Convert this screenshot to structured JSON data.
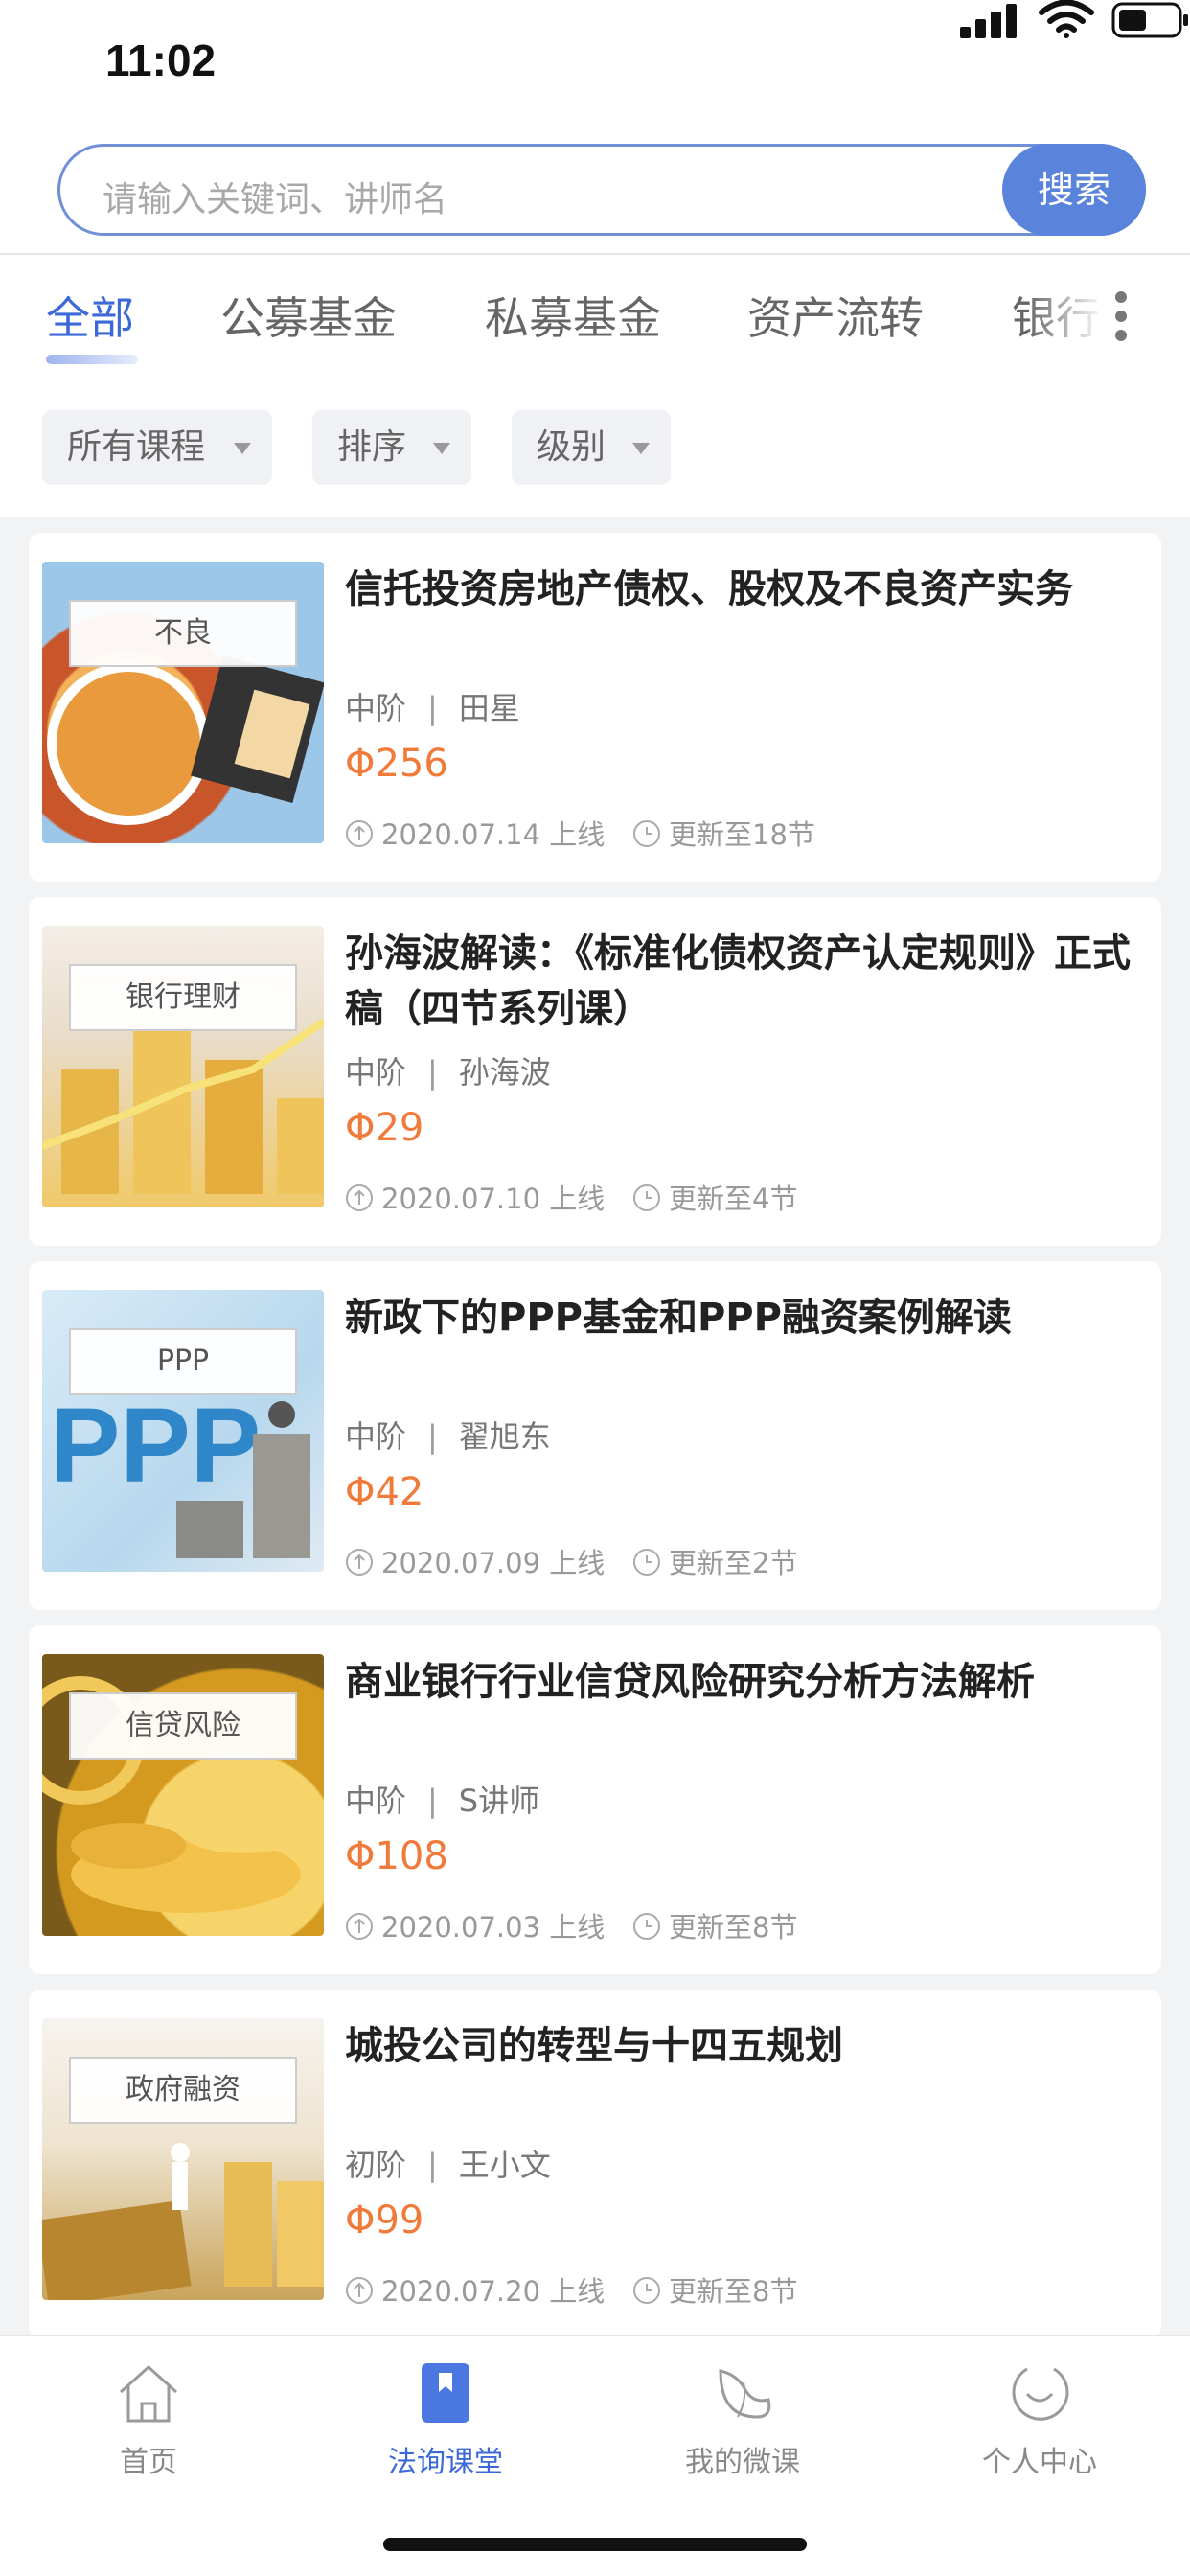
{
  "status_bar": {
    "time": "11:02"
  },
  "search": {
    "placeholder": "请输入关键词、讲师名",
    "button_label": "搜索"
  },
  "tabs": [
    {
      "label": "全部",
      "active": true
    },
    {
      "label": "公募基金",
      "active": false
    },
    {
      "label": "私募基金",
      "active": false
    },
    {
      "label": "资产流转",
      "active": false
    },
    {
      "label": "银行",
      "active": false
    }
  ],
  "filters": [
    {
      "label": "所有课程"
    },
    {
      "label": "排序"
    },
    {
      "label": "级别"
    }
  ],
  "courses": [
    {
      "tag": "不良",
      "title": "信托投资房地产债权、股权及不良资产实务",
      "level": "中阶",
      "separator": "|",
      "teacher": "田星",
      "price": "Φ256",
      "online": "2020.07.14 上线",
      "updated": "更新至18节",
      "thumb_color": "#d9843f"
    },
    {
      "tag": "银行理财",
      "title": "孙海波解读：《标准化债权资产认定规则》正式稿（四节系列课）",
      "level": "中阶",
      "separator": "|",
      "teacher": "孙海波",
      "price": "Φ29",
      "online": "2020.07.10 上线",
      "updated": "更新至4节",
      "thumb_color": "#e8b64c"
    },
    {
      "tag": "PPP",
      "title": "新政下的PPP基金和PPP融资案例解读",
      "level": "中阶",
      "separator": "|",
      "teacher": "翟旭东",
      "price": "Φ42",
      "online": "2020.07.09 上线",
      "updated": "更新至2节",
      "thumb_color": "#6fa9d8"
    },
    {
      "tag": "信贷风险",
      "title": "商业银行行业信贷风险研究分析方法解析",
      "level": "中阶",
      "separator": "|",
      "teacher": "S讲师",
      "price": "Φ108",
      "online": "2020.07.03 上线",
      "updated": "更新至8节",
      "thumb_color": "#d39a1f"
    },
    {
      "tag": "政府融资",
      "title": "城投公司的转型与十四五规划",
      "level": "初阶",
      "separator": "|",
      "teacher": "王小文",
      "price": "Φ99",
      "online": "2020.07.20 上线",
      "updated": "更新至8节",
      "thumb_color": "#e0b255"
    }
  ],
  "tabbar": [
    {
      "label": "首页",
      "icon": "home-icon",
      "active": false
    },
    {
      "label": "法询课堂",
      "icon": "bookmark-icon",
      "active": true
    },
    {
      "label": "我的微课",
      "icon": "leaf-icon",
      "active": false
    },
    {
      "label": "个人中心",
      "icon": "smile-icon",
      "active": false
    }
  ],
  "colors": {
    "accent": "#3c68d8",
    "price": "#f07a3a",
    "search_button": "#5a84dc"
  }
}
